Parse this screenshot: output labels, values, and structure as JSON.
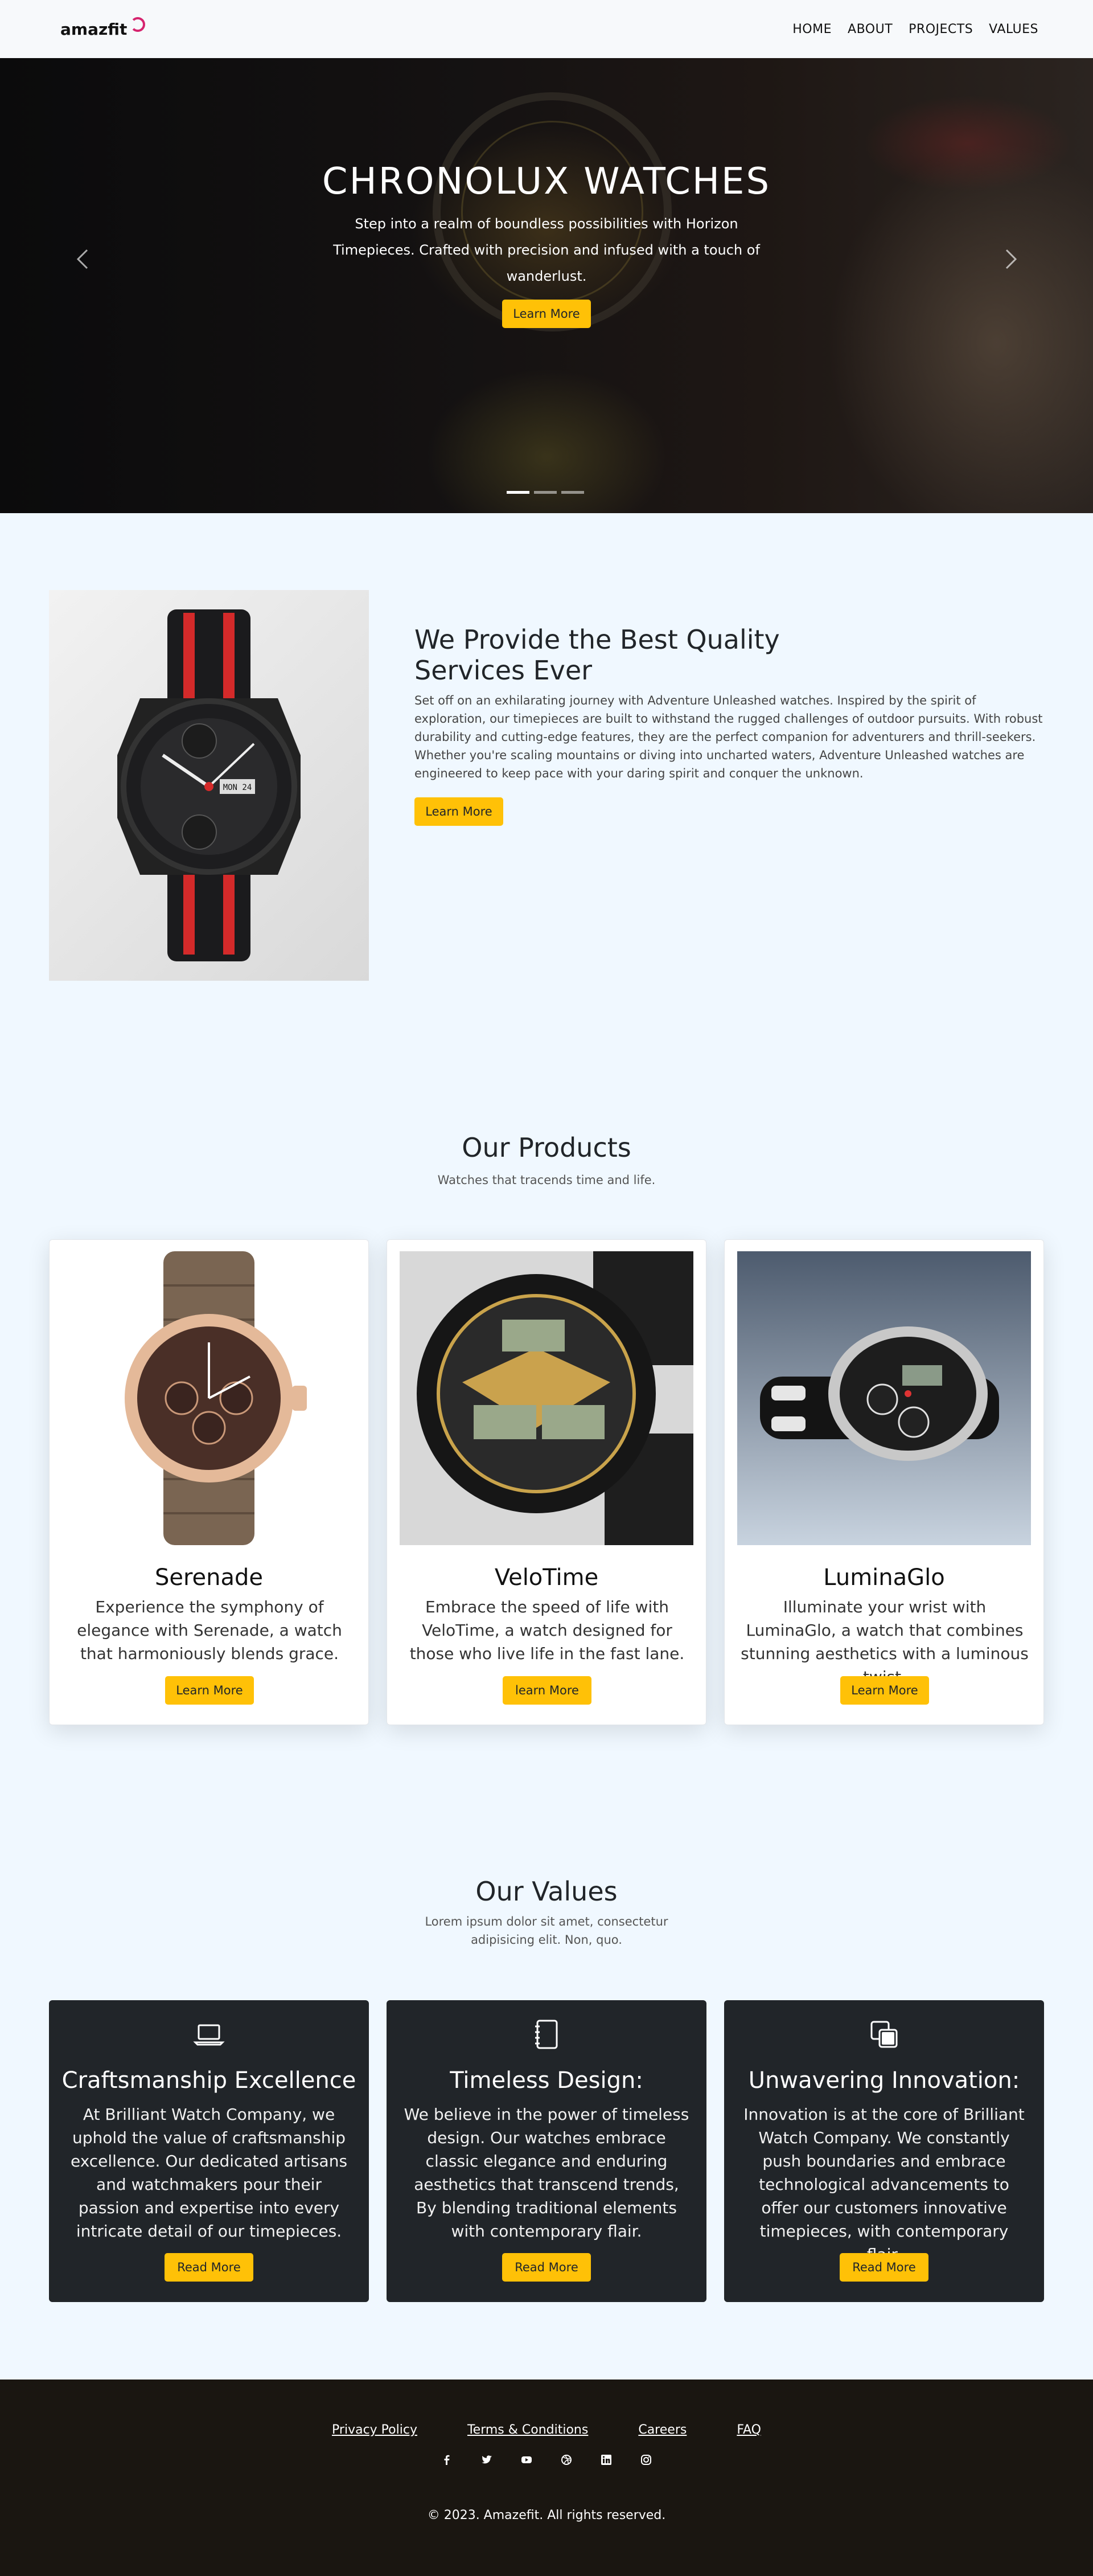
{
  "nav": {
    "brand": "amazfit",
    "links": [
      "HOME",
      "ABOUT",
      "PROJECTS",
      "VALUES"
    ]
  },
  "hero": {
    "title": "CHRONOLUX WATCHES",
    "text": "Step into a realm of boundless possibilities with Horizon Timepieces. Crafted with precision and infused with a touch of wanderlust.",
    "button": "Learn More",
    "prev_icon": "chevron-left-icon",
    "next_icon": "chevron-right-icon",
    "active_slide": 1,
    "slide_count": 3
  },
  "about": {
    "title": "We Provide the Best Quality Services Ever",
    "text": "Set off on an exhilarating journey with Adventure Unleashed watches. Inspired by the spirit of exploration, our timepieces are built to withstand the rugged challenges of outdoor pursuits. With robust durability and cutting-edge features, they are the perfect companion for adventurers and thrill-seekers. Whether you're scaling mountains or diving into uncharted waters, Adventure Unleashed watches are engineered to keep pace with your daring spirit and conquer the unknown.",
    "button": "Learn More",
    "watch_date": "MON 24"
  },
  "products": {
    "title": "Our Products",
    "subtitle": "Watches that tracends time and life.",
    "items": [
      {
        "title": "Serenade",
        "text": "Experience the symphony of elegance with Serenade, a watch that harmoniously blends grace.",
        "button": "Learn More"
      },
      {
        "title": "VeloTime",
        "text": "Embrace the speed of life with VeloTime, a watch designed for those who live life in the fast lane.",
        "button": "learn More"
      },
      {
        "title": "LuminaGlo",
        "text": "Illuminate your wrist with LuminaGlo, a watch that combines stunning aesthetics with a luminous twist.",
        "button": "Learn More"
      }
    ]
  },
  "values": {
    "title": "Our Values",
    "subtitle": "Lorem ipsum dolor sit amet, consectetur adipisicing elit. Non, quo.",
    "items": [
      {
        "icon": "laptop-icon",
        "title": "Craftsmanship Excellence",
        "text": "At Brilliant Watch Company, we uphold the value of craftsmanship excellence. Our dedicated artisans and watchmakers pour their passion and expertise into every intricate detail of our timepieces.",
        "button": "Read More"
      },
      {
        "icon": "notebook-icon",
        "title": "Timeless Design:",
        "text": "We believe in the power of timeless design. Our watches embrace classic elegance and enduring aesthetics that transcend trends, By blending traditional elements with contemporary flair.",
        "button": "Read More"
      },
      {
        "icon": "layers-icon",
        "title": "Unwavering Innovation:",
        "text": "Innovation is at the core of Brilliant Watch Company. We constantly push boundaries and embrace technological advancements to offer our customers innovative timepieces, with contemporary flair.",
        "button": "Read More"
      }
    ]
  },
  "footer": {
    "links": [
      "Privacy Policy",
      "Terms & Conditions",
      "Careers",
      "FAQ"
    ],
    "social": [
      "facebook-icon",
      "twitter-icon",
      "youtube-icon",
      "dribbble-icon",
      "linkedin-icon",
      "instagram-icon"
    ],
    "copyright": "© 2023. Amazefit. All rights reserved."
  },
  "colors": {
    "accent": "#ffc107",
    "dark_card": "#212529",
    "footer_bg": "#1a1611",
    "page_bg": "#f0f8ff"
  }
}
